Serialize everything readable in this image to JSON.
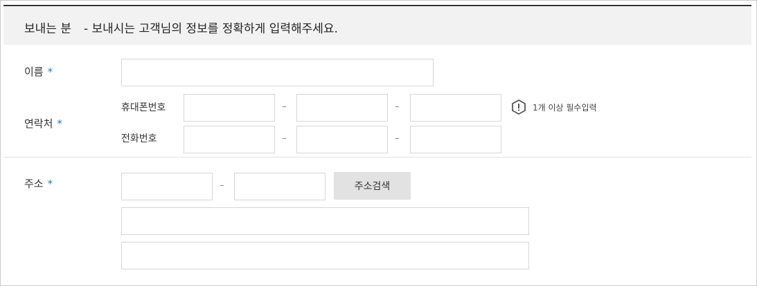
{
  "header": {
    "title": "보내는 분",
    "description": "- 보내시는 고객님의 정보를 정확하게 입력해주세요."
  },
  "form": {
    "name_label": "이름",
    "contact_label": "연락처",
    "mobile_label": "휴대폰번호",
    "phone_label": "전화번호",
    "address_label": "주소",
    "required_mark": "*",
    "dash": "–",
    "notice_text": "1개 이상 필수입력",
    "search_button": "주소검색"
  }
}
